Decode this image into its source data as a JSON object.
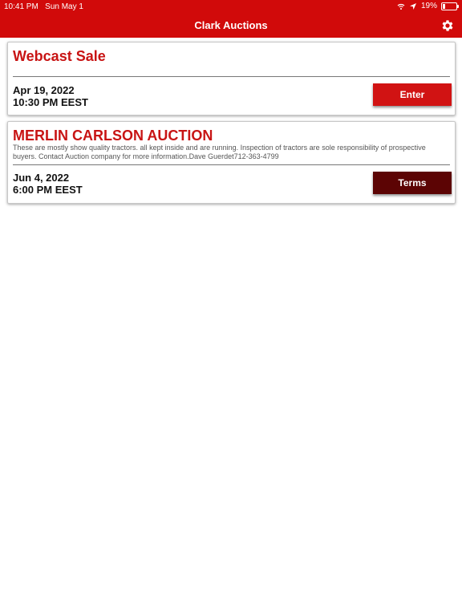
{
  "status_bar": {
    "time": "10:41 PM",
    "date": "Sun May 1",
    "battery": "19%"
  },
  "header": {
    "title": "Clark Auctions",
    "background_color": "#d10a0a",
    "settings_icon": "gear-icon"
  },
  "auctions": [
    {
      "title": "Webcast Sale",
      "description": "",
      "date": "Apr 19, 2022",
      "time": "10:30 PM EEST",
      "button_label": "Enter",
      "button_color": "#d11313"
    },
    {
      "title": "MERLIN CARLSON AUCTION",
      "description": "These are mostly show quality tractors. all kept inside and are running. Inspection of tractors are sole responsibility of prospective buyers. Contact Auction company for more information.Dave Guerdet712-363-4799",
      "date": "Jun 4, 2022",
      "time": "6:00 PM EEST",
      "button_label": "Terms",
      "button_color": "#5c0404"
    }
  ]
}
